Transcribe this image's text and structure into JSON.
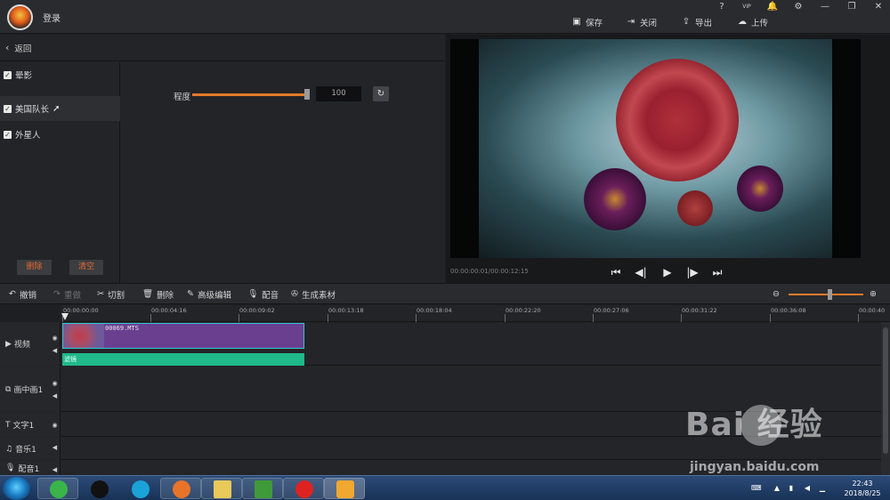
{
  "titlebar": {
    "login_label": "登录",
    "help": "?",
    "vip": "VIP",
    "bell": "🔔",
    "gear": "⚙",
    "minimize": "—",
    "restore": "❐",
    "close": "✕",
    "actions": [
      {
        "label": "保存",
        "icon": "save-icon"
      },
      {
        "label": "关闭",
        "icon": "exit-icon"
      },
      {
        "label": "导出",
        "icon": "export-icon"
      },
      {
        "label": "上传",
        "icon": "upload-icon"
      }
    ]
  },
  "left_panel": {
    "back_label": "返回",
    "filters": [
      {
        "label": "晕影",
        "checked": true
      },
      {
        "label": "美国队长",
        "checked": true,
        "selected": true
      },
      {
        "label": "外星人",
        "checked": true
      }
    ],
    "delete_label": "删除",
    "clear_label": "清空",
    "degree_label": "程度",
    "degree_value": "100",
    "degree_level": 1.0
  },
  "preview": {
    "timecode": "00:00:00:01/00:00:12:15"
  },
  "toolbar": {
    "items": [
      "撤销",
      "重做",
      "切割",
      "删除",
      "高级编辑",
      "配音",
      "生成素材"
    ],
    "zoom_level": 0.55
  },
  "ruler": {
    "ticks": [
      "00:00:00:00",
      "00:00:04:16",
      "00:00:09:02",
      "00:00:13:18",
      "00:00:18:04",
      "00:00:22:20",
      "00:00:27:06",
      "00:00:31:22",
      "00:00:36:08",
      "00:00:40"
    ]
  },
  "tracks": [
    {
      "label": "视频",
      "icon": "video-track-icon"
    },
    {
      "label": "画中画1",
      "icon": "pip-icon"
    },
    {
      "label": "文字1",
      "icon": "text-icon"
    },
    {
      "label": "音乐1",
      "icon": "music-icon"
    },
    {
      "label": "配音1",
      "icon": "mic-icon"
    }
  ],
  "clip": {
    "name": "00069.MTS",
    "effect_label": "滤镜"
  },
  "taskbar": {
    "time": "22:43",
    "date": "2018/8/25"
  },
  "watermark": {
    "brand": "Bai 经验",
    "site": "jingyan.baidu.com"
  }
}
